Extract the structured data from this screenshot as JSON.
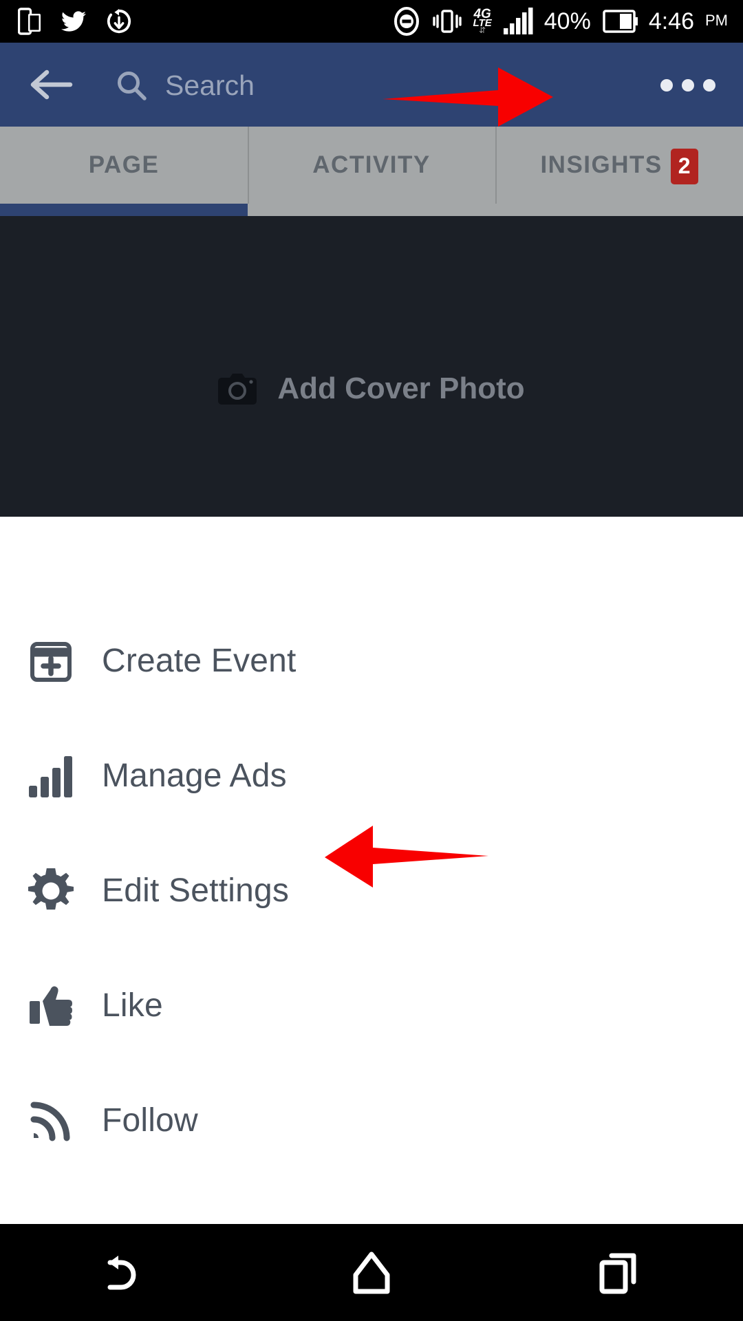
{
  "status_bar": {
    "time": "4:46",
    "meridiem": "PM",
    "battery_percent": "40%",
    "network_primary": "4G",
    "network_secondary": "LTE",
    "icons_left": [
      "multi-window-icon",
      "twitter-icon",
      "sync-icon"
    ],
    "icons_right": [
      "do-not-disturb-icon",
      "vibrate-icon",
      "4g-lte-icon",
      "signal-bars-icon",
      "battery-icon"
    ]
  },
  "app_bar": {
    "back_icon": "back-arrow-icon",
    "search_placeholder": "Search",
    "search_value": "",
    "search_icon": "search-icon",
    "overflow_icon": "overflow-menu-icon",
    "background_color": "#2e4372"
  },
  "tabs": {
    "items": [
      {
        "label": "PAGE",
        "active": true,
        "badge": ""
      },
      {
        "label": "ACTIVITY",
        "active": false,
        "badge": ""
      },
      {
        "label": "INSIGHTS",
        "active": false,
        "badge": "2"
      }
    ],
    "badge_color": "#b12420",
    "indicator_color": "#2e4372"
  },
  "cover": {
    "label": "Add Cover Photo",
    "icon": "camera-icon",
    "background_color": "#1b1f26"
  },
  "menu": {
    "items": [
      {
        "label": "Create Event",
        "icon": "calendar-plus-icon"
      },
      {
        "label": "Manage Ads",
        "icon": "bar-chart-icon"
      },
      {
        "label": "Edit Settings",
        "icon": "gear-icon"
      },
      {
        "label": "Like",
        "icon": "thumbs-up-icon"
      },
      {
        "label": "Follow",
        "icon": "rss-icon"
      }
    ]
  },
  "annotations": {
    "color": "#f80000",
    "arrows": [
      {
        "name": "arrow-pointing-to-overflow-menu",
        "direction": "right",
        "target": "overflow-menu-icon"
      },
      {
        "name": "arrow-pointing-to-edit-settings",
        "direction": "left",
        "target": "Edit Settings"
      }
    ]
  },
  "nav_bar": {
    "buttons": [
      {
        "name": "back-nav-button",
        "icon": "back-curved-arrow-icon"
      },
      {
        "name": "home-nav-button",
        "icon": "home-icon"
      },
      {
        "name": "recents-nav-button",
        "icon": "recents-icon"
      }
    ]
  }
}
